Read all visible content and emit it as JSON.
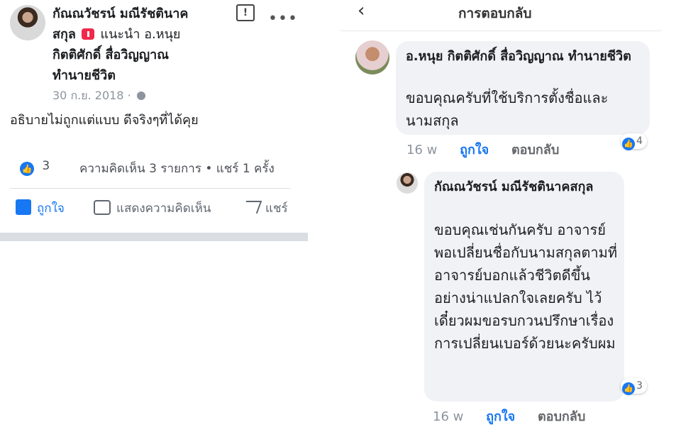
{
  "post": {
    "author_line1": "กัณณวัชรน์ มณีรัชตินาค",
    "author_line2_a": "สกุล",
    "recommend_text": "แนะนำ อ.หนุย",
    "author_line3": "กิตติศักดิ์ สื่อวิญญาณ",
    "author_line4": "ทำนายชีวิต",
    "date": "30 ก.ย. 2018",
    "text": "อธิบายไม่ถูกแต่แบบ ดีจริงๆที่ได้คุย",
    "like_count": "3",
    "stats_text": "ความคิดเห็น 3 รายการ • แชร์ 1 ครั้ง",
    "actions": {
      "like": "ถูกใจ",
      "comment": "แสดงความคิดเห็น",
      "share": "แชร์"
    }
  },
  "replies_panel": {
    "title": "การตอบกลับ",
    "comments": [
      {
        "author": "อ.หนุย กิตติศักดิ์ สื่อวิญญาณ ทำนายชีวิต",
        "text": "ขอบคุณครับที่ใช้บริการตั้งชื่อและนามสกุล",
        "reaction_count": "4",
        "time": "16 w",
        "like_label": "ถูกใจ",
        "reply_label": "ตอบกลับ"
      },
      {
        "author": "กัณณวัชรน์ มณีรัชตินาคสกุล",
        "text": "ขอบคุณเช่นกันครับ อาจารย์ พอเปลี่ยนชื่อกับนามสกุลตามที่อาจารย์บอกแล้วชีวิตดีขึ้นอย่างน่าแปลกใจเลยครับ ไว้เดี๋ยวผมขอรบกวนปรึกษาเรื่องการเปลี่ยนเบอร์ด้วยนะครับผม",
        "reaction_count": "3",
        "time": "16 w",
        "like_label": "ถูกใจ",
        "reply_label": "ตอบกลับ"
      }
    ]
  },
  "colors": {
    "accent": "#1877f2",
    "bubble": "#f0f2f5",
    "muted": "#8d949e",
    "badge": "#f0284a"
  }
}
